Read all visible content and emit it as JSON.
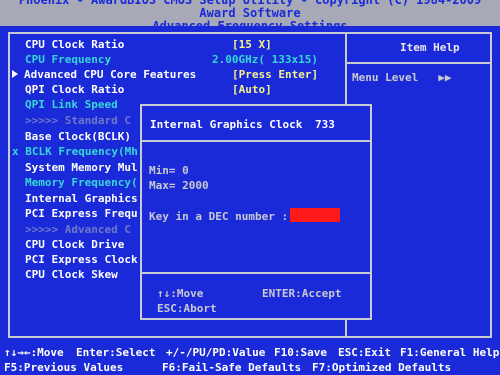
{
  "header": {
    "line1": "Phoenix - AwardBIOS CMOS Setup Utility - Copyright (C) 1984-2009 Award Software",
    "title": "Advanced Frequency Settings"
  },
  "items": [
    {
      "label": "CPU Clock Ratio",
      "value": "[15 X]"
    },
    {
      "label": "CPU Frequency",
      "value": "2.00GHz( 133x15)"
    },
    {
      "label": "Advanced CPU Core Features",
      "value": "[Press Enter]"
    },
    {
      "label": "QPI Clock Ratio",
      "value": "[Auto]"
    },
    {
      "label": "QPI Link Speed"
    },
    {
      "label": ">>>>> Standard C"
    },
    {
      "label": "Base Clock(BCLK)"
    },
    {
      "label": "BCLK Frequency(Mh",
      "prefix": "x"
    },
    {
      "label": "System Memory Mul"
    },
    {
      "label": "Memory Frequency("
    },
    {
      "label": "Internal Graphics"
    },
    {
      "label": "PCI Express Frequ"
    },
    {
      "label": ">>>>> Advanced C"
    },
    {
      "label": "CPU Clock Drive"
    },
    {
      "label": "PCI Express Clock"
    },
    {
      "label": "CPU Clock Skew"
    }
  ],
  "help": {
    "title": "Item Help",
    "menu_level_label": "Menu Level",
    "menu_level_arrows": "▶▶"
  },
  "dialog": {
    "title": "Internal Graphics Clock",
    "current_value": "733",
    "min": "Min=    0",
    "max": "Max= 2000",
    "prompt": "Key in a DEC number :",
    "nav_move": "↑↓:Move",
    "nav_accept": "ENTER:Accept",
    "nav_abort": "ESC:Abort"
  },
  "footer": {
    "move": "↑↓→←:Move",
    "select": "Enter:Select",
    "value": "+/-/PU/PD:Value",
    "save": "F10:Save",
    "exit": "ESC:Exit",
    "help": "F1:General Help",
    "prev": "F5:Previous Values",
    "failsafe": "F6:Fail-Safe Defaults",
    "optimized": "F7:Optimized Defaults"
  },
  "colors": {
    "background": "#1a2ad8",
    "title_bar": "#a7aab6",
    "highlight_text": "#35d7d7",
    "value_text": "#f4f28a",
    "input_box": "#ff1a1a"
  }
}
